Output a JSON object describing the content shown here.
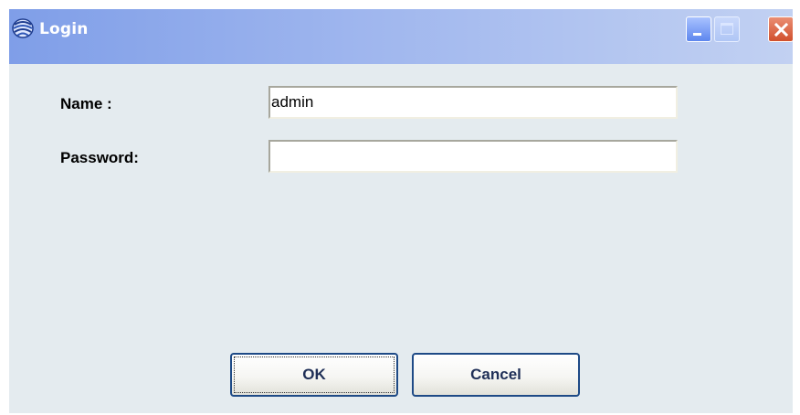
{
  "window": {
    "title": "Login",
    "app_icon": "spiral-app-icon",
    "controls": {
      "minimize_icon": "minimize-icon",
      "maximize_icon": "maximize-icon",
      "close_icon": "close-icon"
    }
  },
  "form": {
    "name_label": "Name :",
    "name_value": "admin",
    "password_label": "Password:",
    "password_value": ""
  },
  "buttons": {
    "ok_label": "OK",
    "cancel_label": "Cancel"
  },
  "colors": {
    "titlebar_start": "#7f9ee8",
    "titlebar_end": "#c2d1f2",
    "client_background": "#e4ebef",
    "close_button": "#d1502d",
    "button_border": "#1e4a86"
  }
}
